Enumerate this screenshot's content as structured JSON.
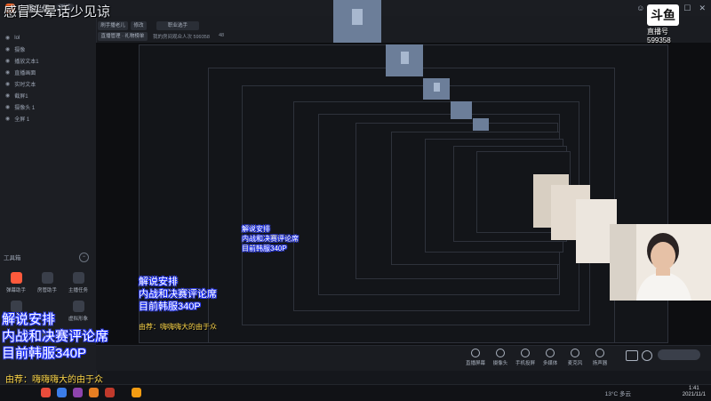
{
  "app": {
    "logo_text": "直播伴侣",
    "version_badge": "测试",
    "window_controls": [
      "☺",
      "⚙",
      "—",
      "☐",
      "✕"
    ]
  },
  "overlay": {
    "stream_title": "感冒头晕话少见谅",
    "info_lines": [
      "解说安排",
      "内战和决赛评论席",
      "目前韩服340P"
    ],
    "danmu": "由荐：嗨嗨嗨大的由于众"
  },
  "topbar": {
    "user_chip": "刷手播老儿",
    "edit_chip": "修改",
    "category_chip": "职业选手",
    "row2_chip": "直播管理 · 礼物榜单",
    "stats": "我的房间观众人次 599358",
    "heat": "48"
  },
  "sidebar": {
    "scenes": [
      {
        "label": "lol"
      },
      {
        "label": "摄像"
      },
      {
        "label": "播放文本1"
      },
      {
        "label": "直播画面"
      },
      {
        "label": "实时文本"
      },
      {
        "label": "截屏1"
      },
      {
        "label": "摄像头 1"
      },
      {
        "label": "全屏 1"
      }
    ],
    "tools_header": "工具箱",
    "tools": [
      {
        "label": "弹幕助手",
        "icon": "danmu-tool-icon",
        "color": "#ff5a3c"
      },
      {
        "label": "房管助手",
        "icon": "manager-tool-icon",
        "color": "#3a3f4a"
      },
      {
        "label": "主播任务",
        "icon": "task-tool-icon",
        "color": "#3a3f4a"
      },
      {
        "label": "超级直播",
        "icon": "super-tool-icon",
        "color": "#3a3f4a"
      },
      {
        "label": "直播设置",
        "icon": "settings-tool-icon",
        "color": "#3a3f4a"
      },
      {
        "label": "虚拟形象",
        "icon": "avatar-tool-icon",
        "color": "#3a3f4a"
      }
    ]
  },
  "bottom_toolbar": {
    "buttons": [
      {
        "label": "直播屏幕",
        "icon": "screen-icon"
      },
      {
        "label": "摄像头",
        "icon": "camera-icon"
      },
      {
        "label": "手机投屏",
        "icon": "phone-cast-icon"
      },
      {
        "label": "多媒体",
        "icon": "media-icon"
      },
      {
        "label": "麦克风",
        "icon": "mic-icon"
      },
      {
        "label": "扬声器",
        "icon": "speaker-icon"
      }
    ]
  },
  "douyu": {
    "logo_text": "斗鱼",
    "sub_text": "直播号",
    "room_number": "599358"
  },
  "taskbar": {
    "weather": "13°C 多云",
    "time": "1:41",
    "date": "2021/11/1"
  }
}
